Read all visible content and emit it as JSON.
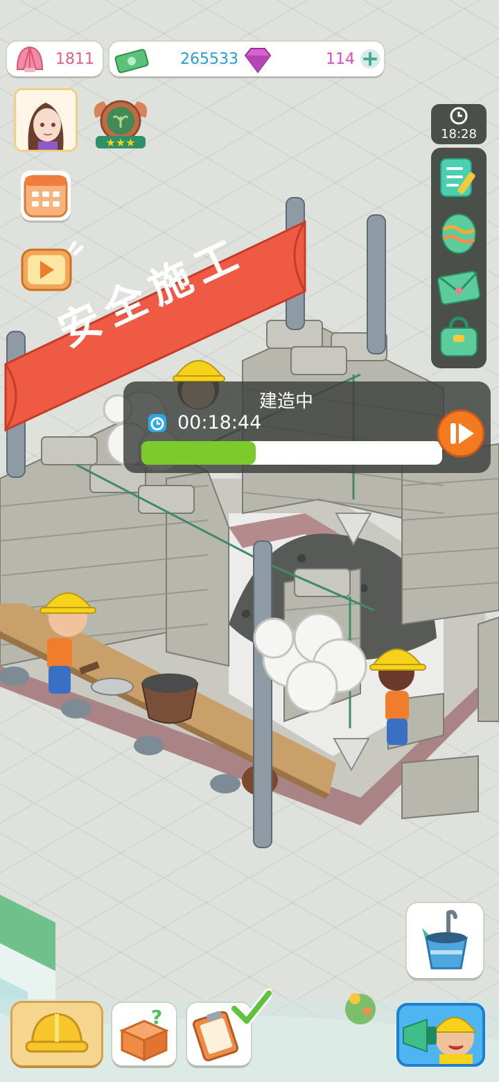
{
  "resources": {
    "shells": "1811",
    "money": "265533",
    "gems": "114"
  },
  "clock": {
    "time": "18:28"
  },
  "banner": {
    "text": "安全施工"
  },
  "build": {
    "status": "建造中",
    "remaining": "00:18:44",
    "progress": 0.38
  },
  "colors": {
    "banner_red": "#ee5a43",
    "progress_green": "#7ccb2c",
    "speed_orange": "#f47a22",
    "helmet_yellow": "#f6d21b",
    "worker_btn_blue": "#4eb4f2"
  },
  "icons": {
    "shell": "shell-icon",
    "money": "cash-icon",
    "gem": "gem-icon",
    "add": "plus-icon",
    "calendar": "calendar-icon",
    "tv": "video-tv-icon",
    "clock": "clock-icon",
    "tasks": "task-list-icon",
    "egg": "easter-egg-icon",
    "mail": "mail-icon",
    "bag": "bag-icon",
    "speed": "fast-forward-icon",
    "helmet": "helmet-icon",
    "mystery_box": "mystery-box-icon",
    "clipboard": "clipboard-icon",
    "check": "check-icon",
    "bucket": "bucket-tools-icon",
    "megaphone": "megaphone-worker-icon"
  }
}
